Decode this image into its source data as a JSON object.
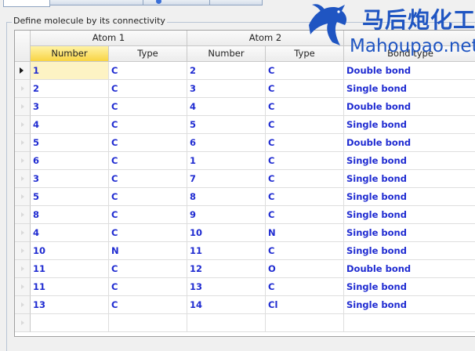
{
  "group_title": "Define molecule by its connectivity",
  "headers": {
    "atom1": "Atom 1",
    "atom2": "Atom 2",
    "columns": [
      "Number",
      "Type",
      "Number",
      "Type",
      "Bond type"
    ]
  },
  "rows": [
    {
      "n1": "1",
      "t1": "C",
      "n2": "2",
      "t2": "C",
      "bond": "Double bond"
    },
    {
      "n1": "2",
      "t1": "C",
      "n2": "3",
      "t2": "C",
      "bond": "Single bond"
    },
    {
      "n1": "3",
      "t1": "C",
      "n2": "4",
      "t2": "C",
      "bond": "Double bond"
    },
    {
      "n1": "4",
      "t1": "C",
      "n2": "5",
      "t2": "C",
      "bond": "Single bond"
    },
    {
      "n1": "5",
      "t1": "C",
      "n2": "6",
      "t2": "C",
      "bond": "Double bond"
    },
    {
      "n1": "6",
      "t1": "C",
      "n2": "1",
      "t2": "C",
      "bond": "Single bond"
    },
    {
      "n1": "3",
      "t1": "C",
      "n2": "7",
      "t2": "C",
      "bond": "Single bond"
    },
    {
      "n1": "5",
      "t1": "C",
      "n2": "8",
      "t2": "C",
      "bond": "Single bond"
    },
    {
      "n1": "8",
      "t1": "C",
      "n2": "9",
      "t2": "C",
      "bond": "Single bond"
    },
    {
      "n1": "4",
      "t1": "C",
      "n2": "10",
      "t2": "N",
      "bond": "Single bond"
    },
    {
      "n1": "10",
      "t1": "N",
      "n2": "11",
      "t2": "C",
      "bond": "Single bond"
    },
    {
      "n1": "11",
      "t1": "C",
      "n2": "12",
      "t2": "O",
      "bond": "Double bond"
    },
    {
      "n1": "11",
      "t1": "C",
      "n2": "13",
      "t2": "C",
      "bond": "Single bond"
    },
    {
      "n1": "13",
      "t1": "C",
      "n2": "14",
      "t2": "Cl",
      "bond": "Single bond"
    },
    {
      "n1": "",
      "t1": "",
      "n2": "",
      "t2": "",
      "bond": ""
    }
  ],
  "watermark": {
    "cn": "马后炮化工",
    "en": "Mahoupao.net",
    "icon": "horse-logo-icon"
  },
  "colors": {
    "cell_text": "#1f2bd1",
    "selected_header": "#f8d443",
    "current_cell": "#fdf3c4",
    "watermark": "#1f55c2"
  }
}
